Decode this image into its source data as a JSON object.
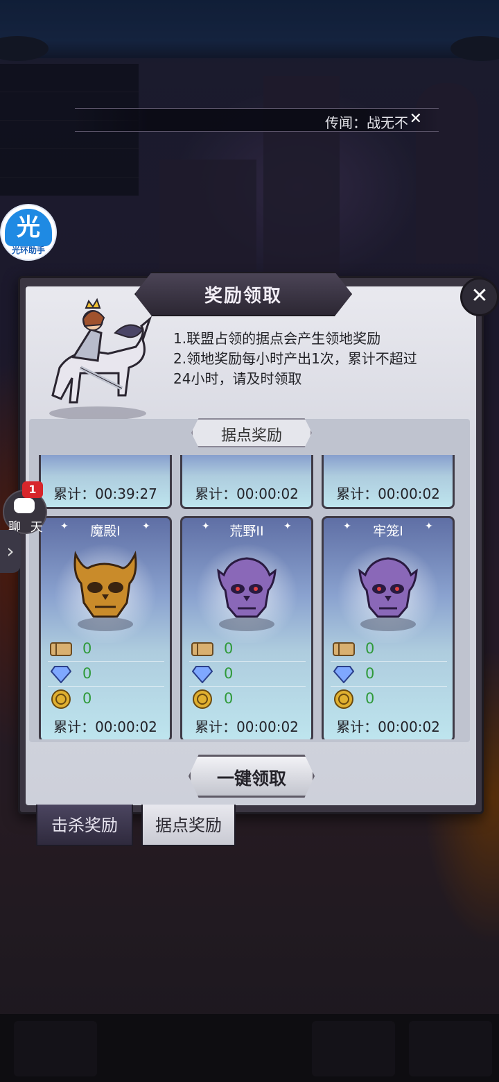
{
  "rumor": {
    "text": "传闻：战无不"
  },
  "helper": {
    "icon_char": "光",
    "caption": "光环助手"
  },
  "chat": {
    "label": "聊 天",
    "badge": "1"
  },
  "modal": {
    "title": "奖励领取",
    "rules": [
      "1.联盟占领的据点会产生领地奖励",
      "2.领地奖励每小时产出1次，累计不超过",
      "24小时，请及时领取"
    ],
    "section_title": "据点奖励",
    "claim_all": "一键领取",
    "tabs": [
      {
        "label": "击杀奖励",
        "active": false
      },
      {
        "label": "据点奖励",
        "active": true
      }
    ],
    "top_cards": [
      {
        "accum": "累计：00:39:27"
      },
      {
        "accum": "累计：00:00:02"
      },
      {
        "accum": "累计：00:00:02"
      }
    ],
    "cards": [
      {
        "name": "魔殿I",
        "skull_color": "gold",
        "ticket": "0",
        "gem": "0",
        "coin": "0",
        "accum": "累计：00:00:02"
      },
      {
        "name": "荒野II",
        "skull_color": "purple",
        "ticket": "0",
        "gem": "0",
        "coin": "0",
        "accum": "累计：00:00:02"
      },
      {
        "name": "牢笼I",
        "skull_color": "purple",
        "ticket": "0",
        "gem": "0",
        "coin": "0",
        "accum": "累计：00:00:02"
      }
    ]
  },
  "colors": {
    "value_green": "#2f9a3a",
    "badge_red": "#d7262b",
    "helper_blue": "#1f8ae3"
  },
  "icons": [
    "close-icon",
    "ticket-icon",
    "gem-icon",
    "coin-icon",
    "skull-icon",
    "chat-icon",
    "chevron-right-icon"
  ]
}
